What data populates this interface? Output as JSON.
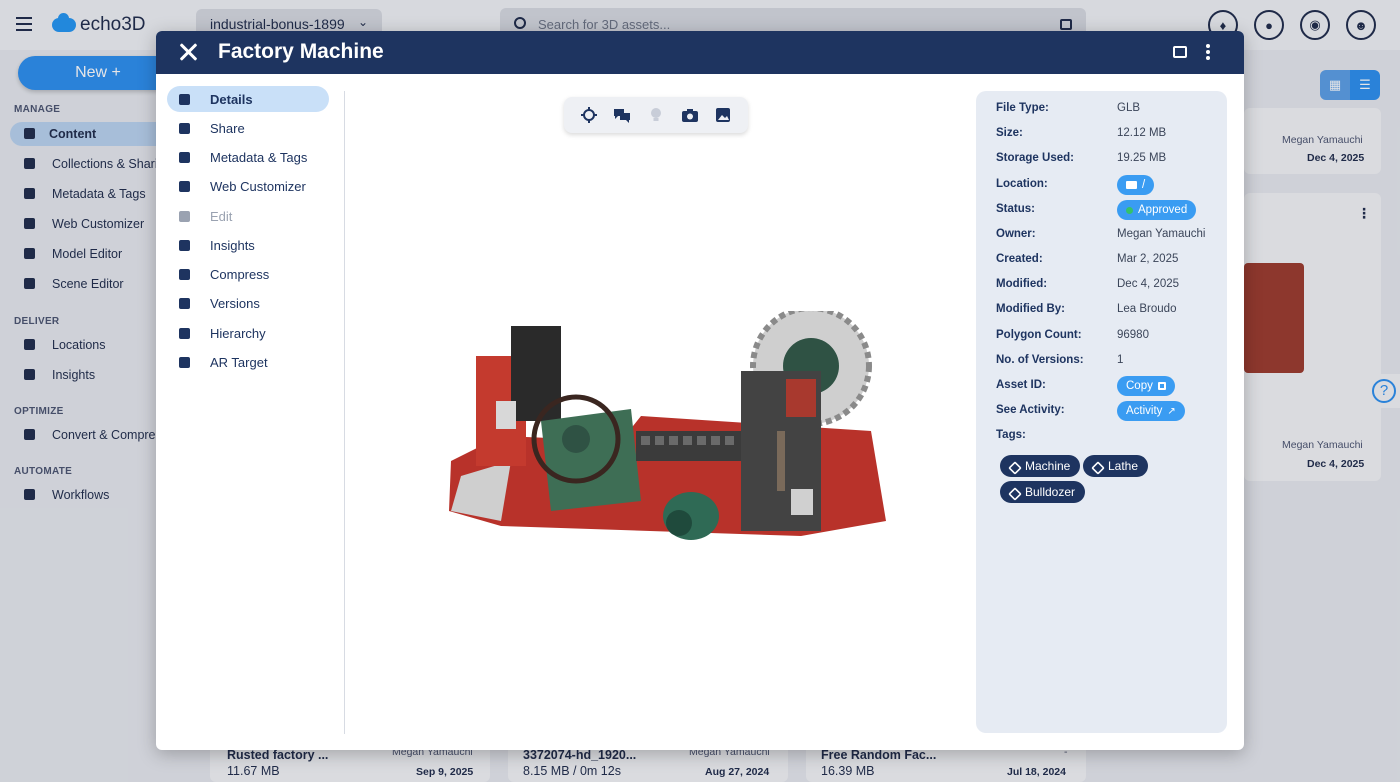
{
  "app": {
    "logo": "echo3D",
    "project": "industrial-bonus-1899"
  },
  "search": {
    "placeholder": "Search for 3D assets..."
  },
  "sidebar": {
    "new_button": "New +",
    "sections": [
      "MANAGE",
      "DELIVER",
      "OPTIMIZE",
      "AUTOMATE"
    ],
    "items": [
      {
        "label": "Content",
        "icon": "cube-icon",
        "active": true
      },
      {
        "label": "Collections & Sharing",
        "icon": "grid-icon"
      },
      {
        "label": "Metadata & Tags",
        "icon": "tag-icon"
      },
      {
        "label": "Web Customizer",
        "icon": "vr-icon"
      },
      {
        "label": "Model Editor",
        "icon": "pencil-icon"
      },
      {
        "label": "Scene Editor",
        "icon": "scene-icon"
      },
      {
        "label": "Locations",
        "icon": "pin-icon"
      },
      {
        "label": "Insights",
        "icon": "chart-icon"
      },
      {
        "label": "Convert & Compress",
        "icon": "compress-icon"
      },
      {
        "label": "Workflows",
        "icon": "workflow-icon"
      }
    ]
  },
  "bg_cards": [
    {
      "owner": "Megan Yamauchi",
      "date": "Dec 4, 2025"
    },
    {
      "owner": "Megan Yamauchi",
      "date": "Dec 4, 2025"
    },
    {
      "name": "Rusted factory ...",
      "size": "11.67 MB",
      "owner": "Megan Yamauchi",
      "date": "Sep 9, 2025"
    },
    {
      "name": "3372074-hd_1920...",
      "size": "8.15 MB / 0m 12s",
      "owner": "Megan Yamauchi",
      "date": "Aug 27, 2024"
    },
    {
      "name": "Free Random Fac...",
      "size": "16.39 MB",
      "owner": "-",
      "date": "Jul 18, 2024"
    }
  ],
  "modal": {
    "title": "Factory Machine",
    "nav": [
      {
        "label": "Details",
        "icon": "cube-icon",
        "active": true
      },
      {
        "label": "Share",
        "icon": "add-person-icon"
      },
      {
        "label": "Metadata & Tags",
        "icon": "tag-icon"
      },
      {
        "label": "Web Customizer",
        "icon": "vr-icon"
      },
      {
        "label": "Edit",
        "icon": "lock-icon",
        "disabled": true
      },
      {
        "label": "Insights",
        "icon": "chart-icon"
      },
      {
        "label": "Compress",
        "icon": "compress-icon"
      },
      {
        "label": "Versions",
        "icon": "versions-icon"
      },
      {
        "label": "Hierarchy",
        "icon": "hierarchy-icon"
      },
      {
        "label": "AR Target",
        "icon": "qr-icon"
      }
    ],
    "viewer_tools": [
      "crosshair-icon",
      "comments-icon",
      "lightbulb-icon",
      "camera-icon",
      "image-icon"
    ],
    "properties": {
      "file_type": {
        "label": "File Type:",
        "value": "GLB"
      },
      "size": {
        "label": "Size:",
        "value": "12.12 MB"
      },
      "storage": {
        "label": "Storage Used:",
        "value": "19.25 MB"
      },
      "location": {
        "label": "Location:",
        "value": "/"
      },
      "status": {
        "label": "Status:",
        "value": "Approved"
      },
      "owner": {
        "label": "Owner:",
        "value": "Megan Yamauchi"
      },
      "created": {
        "label": "Created:",
        "value": "Mar 2, 2025"
      },
      "modified": {
        "label": "Modified:",
        "value": "Dec 4, 2025"
      },
      "modified_by": {
        "label": "Modified By:",
        "value": "Lea Broudo"
      },
      "polygons": {
        "label": "Polygon Count:",
        "value": "96980"
      },
      "versions": {
        "label": "No. of Versions:",
        "value": "1"
      },
      "asset_id": {
        "label": "Asset ID:",
        "value": "Copy"
      },
      "activity": {
        "label": "See Activity:",
        "value": "Activity"
      },
      "tags_label": "Tags:"
    },
    "tags": [
      "Machine",
      "Lathe",
      "Bulldozer"
    ]
  },
  "colors": {
    "header": "#1e3460",
    "accent": "#3a9cf2",
    "status_dot": "#34c26a"
  }
}
